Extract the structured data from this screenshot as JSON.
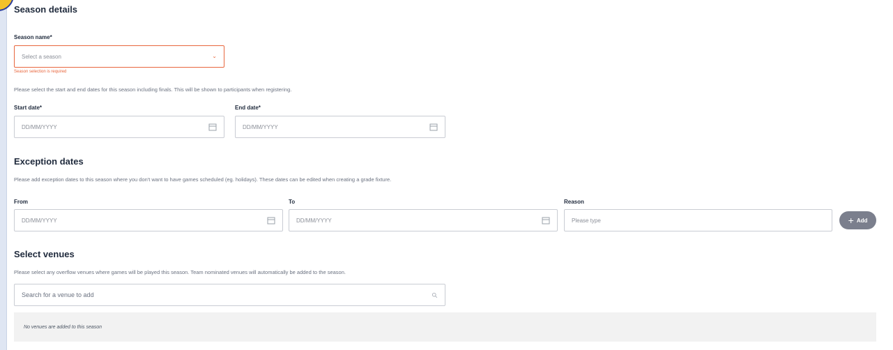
{
  "season": {
    "title": "Season details",
    "name_label": "Season name*",
    "select_placeholder": "Select a season",
    "error": "Season selection is required",
    "help": "Please select the start and end dates for this season including finals. This will be shown to participants when registering.",
    "start_label": "Start date*",
    "end_label": "End date*",
    "date_placeholder": "DD/MM/YYYY"
  },
  "exceptions": {
    "title": "Exception dates",
    "help": "Please add exception dates to this season where you don't want to have games scheduled (eg. holidays). These dates can be edited when creating a grade fixture.",
    "from_label": "From",
    "to_label": "To",
    "reason_label": "Reason",
    "date_placeholder": "DD/MM/YYYY",
    "reason_placeholder": "Please type",
    "add_label": "Add"
  },
  "venues": {
    "title": "Select venues",
    "help": "Please select any overflow venues where games will be played this season. Team nominated venues will automatically be added to the season.",
    "search_placeholder": "Search for a venue to add",
    "empty": "No venues are added to this season"
  },
  "colors": {
    "error": "#e8663d",
    "button": "#7b7f8d",
    "heading": "#1f2a3c"
  }
}
